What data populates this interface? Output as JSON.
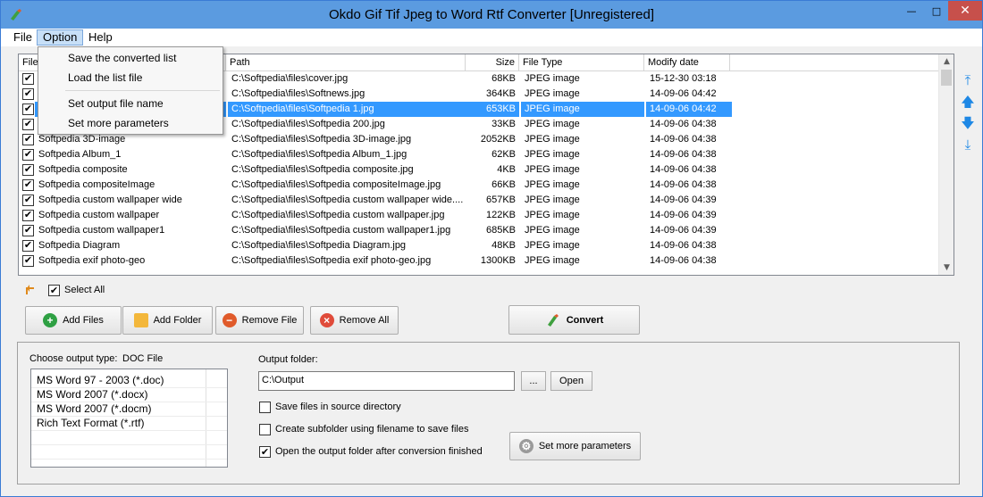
{
  "window": {
    "title": "Okdo Gif Tif Jpeg to Word Rtf Converter [Unregistered]"
  },
  "titlebar": {
    "min": "—",
    "max": "□",
    "close": "✕"
  },
  "menubar": {
    "file": "File",
    "option": "Option",
    "help": "Help"
  },
  "option_menu": {
    "items": [
      "Save the converted list",
      "Load the list file",
      "Set output file name",
      "Set more parameters"
    ]
  },
  "list": {
    "columns": [
      "File",
      "Path",
      "Size",
      "File Type",
      "Modify date"
    ],
    "rows": [
      {
        "name": "",
        "path": "C:\\Softpedia\\files\\cover.jpg",
        "size": "68KB",
        "type": "JPEG image",
        "date": "15-12-30 03:18"
      },
      {
        "name": "",
        "path": "C:\\Softpedia\\files\\Softnews.jpg",
        "size": "364KB",
        "type": "JPEG image",
        "date": "14-09-06 04:42"
      },
      {
        "name": "",
        "path": "C:\\Softpedia\\files\\Softpedia 1.jpg",
        "size": "653KB",
        "type": "JPEG image",
        "date": "14-09-06 04:42"
      },
      {
        "name": "",
        "path": "C:\\Softpedia\\files\\Softpedia 200.jpg",
        "size": "33KB",
        "type": "JPEG image",
        "date": "14-09-06 04:38"
      },
      {
        "name": "Softpedia 3D-image",
        "path": "C:\\Softpedia\\files\\Softpedia 3D-image.jpg",
        "size": "2052KB",
        "type": "JPEG image",
        "date": "14-09-06 04:38"
      },
      {
        "name": "Softpedia Album_1",
        "path": "C:\\Softpedia\\files\\Softpedia Album_1.jpg",
        "size": "62KB",
        "type": "JPEG image",
        "date": "14-09-06 04:38"
      },
      {
        "name": "Softpedia composite",
        "path": "C:\\Softpedia\\files\\Softpedia composite.jpg",
        "size": "4KB",
        "type": "JPEG image",
        "date": "14-09-06 04:38"
      },
      {
        "name": "Softpedia compositeImage",
        "path": "C:\\Softpedia\\files\\Softpedia compositeImage.jpg",
        "size": "66KB",
        "type": "JPEG image",
        "date": "14-09-06 04:38"
      },
      {
        "name": "Softpedia custom wallpaper wide",
        "path": "C:\\Softpedia\\files\\Softpedia custom wallpaper wide....",
        "size": "657KB",
        "type": "JPEG image",
        "date": "14-09-06 04:39"
      },
      {
        "name": "Softpedia custom wallpaper",
        "path": "C:\\Softpedia\\files\\Softpedia custom wallpaper.jpg",
        "size": "122KB",
        "type": "JPEG image",
        "date": "14-09-06 04:39"
      },
      {
        "name": "Softpedia custom wallpaper1",
        "path": "C:\\Softpedia\\files\\Softpedia custom wallpaper1.jpg",
        "size": "685KB",
        "type": "JPEG image",
        "date": "14-09-06 04:39"
      },
      {
        "name": "Softpedia Diagram",
        "path": "C:\\Softpedia\\files\\Softpedia Diagram.jpg",
        "size": "48KB",
        "type": "JPEG image",
        "date": "14-09-06 04:38"
      },
      {
        "name": "Softpedia exif photo-geo",
        "path": "C:\\Softpedia\\files\\Softpedia exif photo-geo.jpg",
        "size": "1300KB",
        "type": "JPEG image",
        "date": "14-09-06 04:38"
      }
    ]
  },
  "select_all": "Select All",
  "buttons": {
    "add_files": "Add Files",
    "add_folder": "Add Folder",
    "remove_file": "Remove File",
    "remove_all": "Remove All",
    "convert": "Convert"
  },
  "output": {
    "type_label": "Choose output type:",
    "type_value": "DOC File",
    "types": [
      "MS Word 97 - 2003 (*.doc)",
      "MS Word 2007 (*.docx)",
      "MS Word 2007 (*.docm)",
      "Rich Text Format (*.rtf)"
    ],
    "folder_label": "Output folder:",
    "folder_value": "C:\\Output",
    "browse": "...",
    "open": "Open",
    "opt_source": "Save files in source directory",
    "opt_subfolder": "Create subfolder using filename to save files",
    "opt_open": "Open the output folder after conversion finished",
    "more_params": "Set more parameters"
  },
  "colors": {
    "title_bg": "#5b9be0",
    "selection": "#3399ff",
    "close": "#c7504b",
    "arrow": "#1e88e5"
  }
}
